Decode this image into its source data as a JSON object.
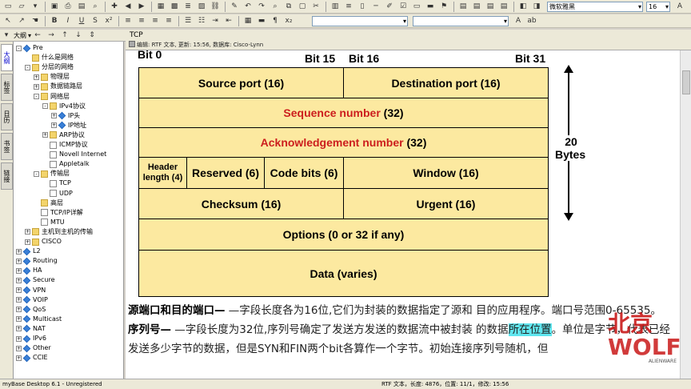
{
  "app": {
    "title": "myBase Desktop 6.1 - Unregistered"
  },
  "toolbar": {
    "font_name": "微软雅黑",
    "font_size": "16",
    "outline_combo": "大纲"
  },
  "sidebar": {
    "tabs": [
      "大纲",
      "标签",
      "日历",
      "书签",
      "链接"
    ],
    "items": [
      {
        "label": "Pre",
        "level": 0,
        "icon": "gem-icon",
        "expander": "-"
      },
      {
        "label": "什么是网络",
        "level": 1,
        "icon": "folder-icon",
        "expander": ""
      },
      {
        "label": "分层的网络",
        "level": 1,
        "icon": "folder-icon",
        "expander": "-"
      },
      {
        "label": "物理层",
        "level": 2,
        "icon": "folder-icon",
        "expander": "+"
      },
      {
        "label": "数据链路层",
        "level": 2,
        "icon": "folder-icon",
        "expander": "+"
      },
      {
        "label": "网络层",
        "level": 2,
        "icon": "folder-icon",
        "expander": "-"
      },
      {
        "label": "IPv4协议",
        "level": 3,
        "icon": "folder-icon",
        "expander": "-"
      },
      {
        "label": "IP头",
        "level": 4,
        "icon": "gem-icon",
        "expander": "+"
      },
      {
        "label": "IP地址",
        "level": 4,
        "icon": "gem-icon",
        "expander": "+"
      },
      {
        "label": "ARP协议",
        "level": 3,
        "icon": "folder-icon",
        "expander": "+"
      },
      {
        "label": "ICMP协议",
        "level": 3,
        "icon": "page-icon",
        "expander": ""
      },
      {
        "label": "Novell Internet",
        "level": 3,
        "icon": "page-icon",
        "expander": ""
      },
      {
        "label": "Appletalk",
        "level": 3,
        "icon": "page-icon",
        "expander": ""
      },
      {
        "label": "传输层",
        "level": 2,
        "icon": "folder-icon",
        "expander": "-"
      },
      {
        "label": "TCP",
        "level": 3,
        "icon": "page-icon",
        "expander": ""
      },
      {
        "label": "UDP",
        "level": 3,
        "icon": "page-icon",
        "expander": ""
      },
      {
        "label": "高层",
        "level": 2,
        "icon": "folder-icon",
        "expander": ""
      },
      {
        "label": "TCP/IP详解",
        "level": 2,
        "icon": "page-icon",
        "expander": ""
      },
      {
        "label": "MTU",
        "level": 2,
        "icon": "page-icon",
        "expander": ""
      },
      {
        "label": "主机到主机的传输",
        "level": 1,
        "icon": "folder-icon",
        "expander": "+"
      },
      {
        "label": "CISCO",
        "level": 1,
        "icon": "folder-icon",
        "expander": "+"
      },
      {
        "label": "L2",
        "level": 0,
        "icon": "gem-icon",
        "expander": "+"
      },
      {
        "label": "Routing",
        "level": 0,
        "icon": "gem-icon",
        "expander": "+"
      },
      {
        "label": "HA",
        "level": 0,
        "icon": "gem-icon",
        "expander": "+"
      },
      {
        "label": "Secure",
        "level": 0,
        "icon": "gem-icon",
        "expander": "+"
      },
      {
        "label": "VPN",
        "level": 0,
        "icon": "gem-icon",
        "expander": "+"
      },
      {
        "label": "VOIP",
        "level": 0,
        "icon": "gem-icon",
        "expander": "+"
      },
      {
        "label": "QoS",
        "level": 0,
        "icon": "gem-icon",
        "expander": "+"
      },
      {
        "label": "Multicast",
        "level": 0,
        "icon": "gem-icon",
        "expander": "+"
      },
      {
        "label": "NAT",
        "level": 0,
        "icon": "gem-icon",
        "expander": "+"
      },
      {
        "label": "IPv6",
        "level": 0,
        "icon": "gem-icon",
        "expander": "+"
      },
      {
        "label": "Other",
        "level": 0,
        "icon": "gem-icon",
        "expander": "+"
      },
      {
        "label": "CCIE",
        "level": 0,
        "icon": "gem-icon",
        "expander": "+"
      }
    ]
  },
  "document": {
    "title": "TCP",
    "meta": "编辑: RTF 文本, 更新: 15:56, 数据库: Cisco-Lynn"
  },
  "diagram": {
    "bit_labels": {
      "b0": "Bit 0",
      "b15": "Bit 15",
      "b16": "Bit 16",
      "b31": "Bit 31"
    },
    "size_label": {
      "num": "20",
      "unit": "Bytes"
    },
    "fields": {
      "source_port": "Source port (16)",
      "dest_port": "Destination port (16)",
      "seq": "Sequence number",
      "seq_bits": "(32)",
      "ack": "Acknowledgement number",
      "ack_bits": "(32)",
      "header_l1": "Header",
      "header_l2": "length (4)",
      "reserved": "Reserved (6)",
      "code_bits": "Code bits (6)",
      "window": "Window (16)",
      "checksum": "Checksum (16)",
      "urgent": "Urgent (16)",
      "options": "Options (0 or 32 if any)",
      "data": "Data (varies)"
    },
    "colors": {
      "fill": "#fce9a0",
      "accent": "#cc1e1e"
    }
  },
  "body": {
    "p1_bold": "源端口和目的端口—",
    "p1_text": " —字段长度各为16位,它们为封装的数据指定了源和 目的应用程序。端口号范围0-65535。",
    "p2_bold": "序列号—",
    "p2_text_a": " —字段长度为32位,序列号确定了发送方发送的数据流中被封装 的数据",
    "p2_highlight": "所在位置",
    "p2_text_b": "。单位是字节，代表已经发送多少字节的数据，但是SYN和FIN两个bit各算作一个字节。初始连接序列号随机，但"
  },
  "watermark": {
    "line1": "北京",
    "line2": "WOLF",
    "brand": "ALIENWARE"
  },
  "status": {
    "left": "myBase Desktop 6.1 - Unregistered",
    "right": "RTF 文本，长度: 4876，位置: 11/1，修改: 15:56"
  }
}
